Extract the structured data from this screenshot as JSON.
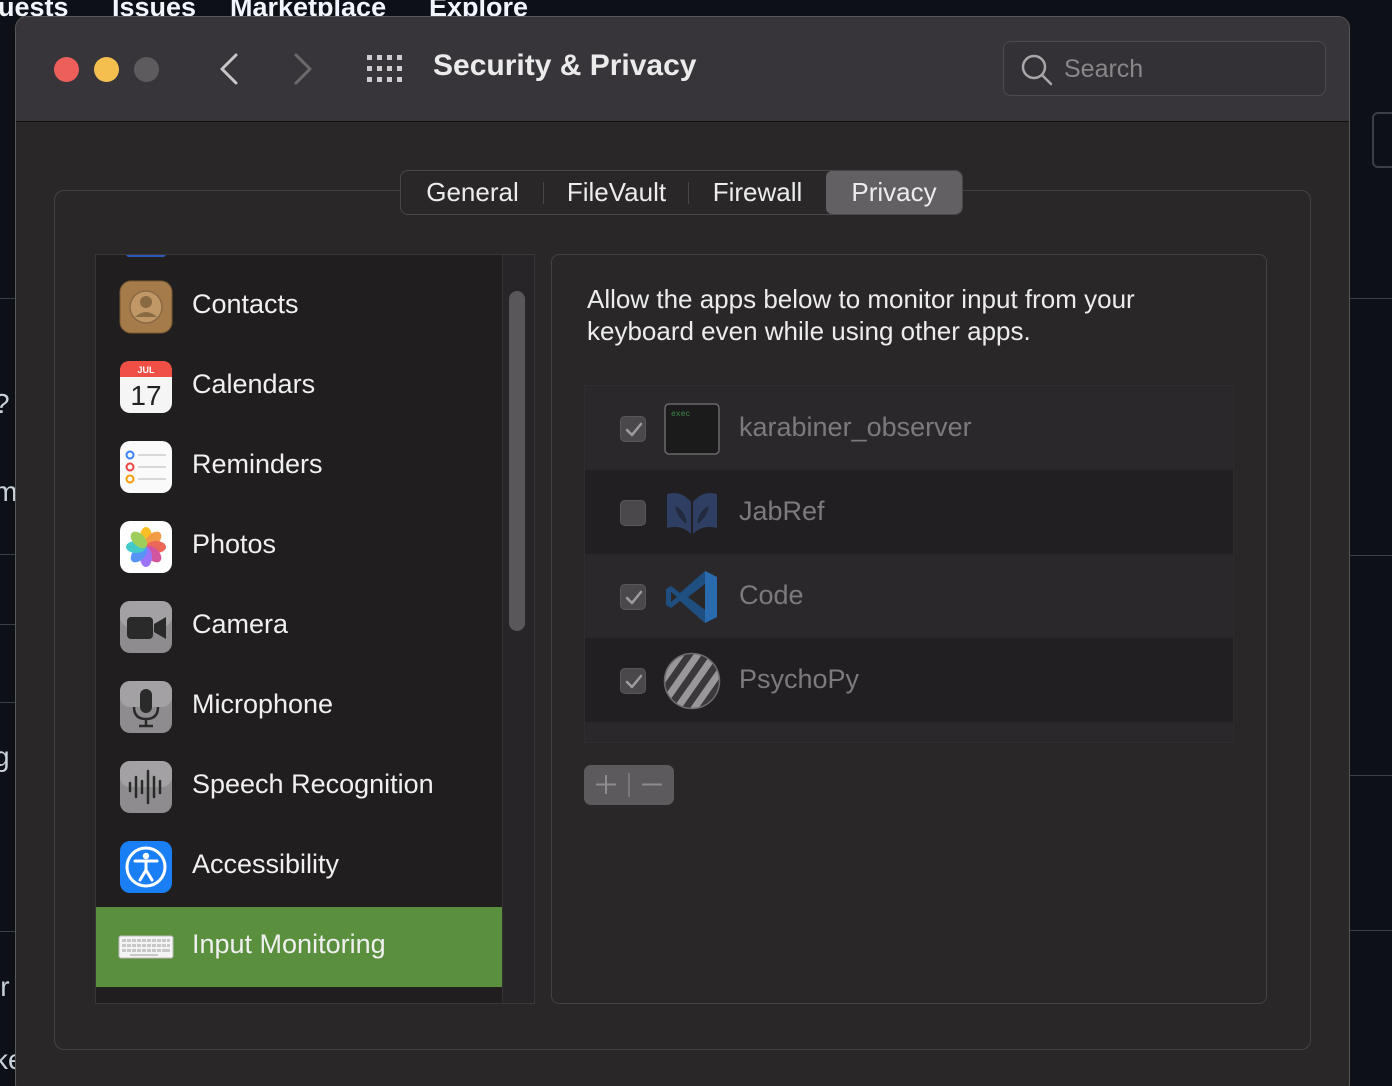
{
  "background": {
    "nav_items": [
      "uests",
      "Issues",
      "Marketplace",
      "Explore"
    ],
    "left_chars": [
      "?",
      "m",
      "g",
      "ir",
      "ke"
    ]
  },
  "window": {
    "title": "Security & Privacy",
    "search": {
      "placeholder": "Search"
    },
    "icons": {
      "back": "chevron-left-icon",
      "forward": "chevron-right-icon",
      "show_all": "grid-icon",
      "search": "search-icon"
    }
  },
  "tabs": [
    {
      "label": "General",
      "selected": false
    },
    {
      "label": "FileVault",
      "selected": false
    },
    {
      "label": "Firewall",
      "selected": false
    },
    {
      "label": "Privacy",
      "selected": true
    }
  ],
  "sidebar": {
    "items": [
      {
        "label": "Contacts",
        "icon": "contacts-icon"
      },
      {
        "label": "Calendars",
        "icon": "calendar-icon",
        "icon_month": "JUL",
        "icon_day": "17"
      },
      {
        "label": "Reminders",
        "icon": "reminders-icon"
      },
      {
        "label": "Photos",
        "icon": "photos-icon"
      },
      {
        "label": "Camera",
        "icon": "camera-icon"
      },
      {
        "label": "Microphone",
        "icon": "microphone-icon"
      },
      {
        "label": "Speech Recognition",
        "icon": "waveform-icon"
      },
      {
        "label": "Accessibility",
        "icon": "accessibility-icon"
      },
      {
        "label": "Input Monitoring",
        "icon": "keyboard-icon",
        "selected": true
      }
    ]
  },
  "panel": {
    "description": "Allow the apps below to monitor input from your keyboard even while using other apps.",
    "apps": [
      {
        "name": "karabiner_observer",
        "checked": true,
        "icon": "terminal-exec-icon",
        "icon_text": "exec"
      },
      {
        "name": "JabRef",
        "checked": false,
        "icon": "jabref-icon"
      },
      {
        "name": "Code",
        "checked": true,
        "icon": "vscode-icon"
      },
      {
        "name": "PsychoPy",
        "checked": true,
        "icon": "psychopy-icon"
      }
    ],
    "add_label": "+",
    "remove_label": "−"
  },
  "colors": {
    "selection": "#5a8f3e",
    "close": "#ec5f5a",
    "minimize": "#f4bf4f"
  }
}
